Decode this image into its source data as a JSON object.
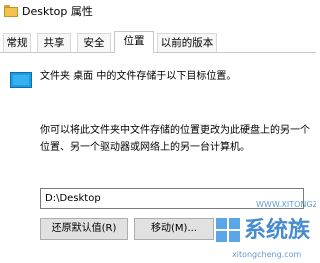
{
  "window": {
    "title": "Desktop 属性",
    "icon": "folder-icon"
  },
  "tabs": [
    {
      "label": "常规",
      "active": false
    },
    {
      "label": "共享",
      "active": false
    },
    {
      "label": "安全",
      "active": false
    },
    {
      "label": "位置",
      "active": true
    },
    {
      "label": "以前的版本",
      "active": false
    }
  ],
  "location": {
    "icon": "desktop-monitor-icon",
    "description": "文件夹 桌面 中的文件存储于以下目标位置。",
    "explanation_line1": "你可以将此文件夹中文件存储的位置更改为此硬盘上的另一个",
    "explanation_line2": "位置、另一个驱动器或网络上的另一台计算机。",
    "path_value": "D:\\Desktop"
  },
  "buttons": {
    "restore_default": "还原默认值(R)",
    "move": "移动(M)..."
  },
  "watermark": {
    "top_text": "WWW.XITONGZU.COM",
    "brand": "系统族",
    "url": "xitongcheng.com"
  },
  "colors": {
    "icon_blue": "#1f9be0",
    "watermark_blue": "#2878c8"
  }
}
